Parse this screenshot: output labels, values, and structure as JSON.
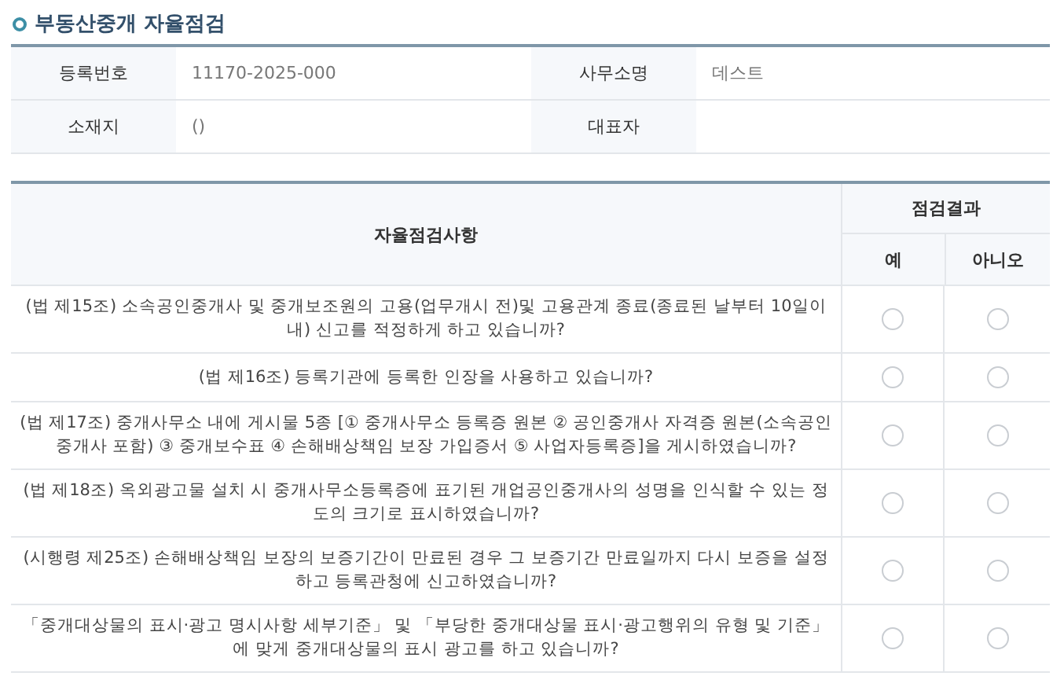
{
  "title": "부동산중개 자율점검",
  "info_rows": [
    [
      {
        "label": "등록번호",
        "value": "11170-2025-000"
      },
      {
        "label": "사무소명",
        "value": "데스트"
      }
    ],
    [
      {
        "label": "소재지",
        "value": "()"
      },
      {
        "label": "대표자"
      }
    ]
  ],
  "checklist": {
    "item_header": "자율점검사항",
    "result_header": "점검결과",
    "options": [
      "예",
      "아니오"
    ],
    "rows": [
      {
        "text": "(법 제15조) 소속공인중개사 및 중개보조원의 고용(업무개시 전)및 고용관계 종료(종료된 날부터 10일이내) 신고를 적정하게 하고 있습니까?",
        "answers": [
          {
            "selected": false
          },
          {
            "selected": false
          }
        ]
      },
      {
        "text": "(법 제16조) 등록기관에 등록한 인장을 사용하고 있습니까?",
        "answers": [
          {
            "selected": false
          },
          {
            "selected": false
          }
        ]
      },
      {
        "text": "(법 제17조) 중개사무소 내에 게시물 5종 [① 중개사무소 등록증 원본 ② 공인중개사 자격증 원본(소속공인중개사 포함) ③ 중개보수표 ④ 손해배상책임 보장 가입증서 ⑤ 사업자등록증]을 게시하였습니까?",
        "answers": [
          {
            "selected": false
          },
          {
            "selected": false
          }
        ]
      },
      {
        "text": "(법 제18조) 옥외광고물 설치 시 중개사무소등록증에 표기된 개업공인중개사의 성명을 인식할 수 있는 정도의 크기로 표시하였습니까?",
        "answers": [
          {
            "selected": false
          },
          {
            "selected": false
          }
        ]
      },
      {
        "text": "(시행령 제25조) 손해배상책임 보장의 보증기간이 만료된 경우 그 보증기간 만료일까지 다시 보증을 설정하고 등록관청에 신고하였습니까?",
        "answers": [
          {
            "selected": false
          },
          {
            "selected": false
          }
        ]
      },
      {
        "text": "「중개대상물의 표시·광고 명시사항 세부기준」 및 「부당한 중개대상물 표시·광고행위의 유형 및 기준」에 맞게 중개대상물의 표시 광고를 하고 있습니까?",
        "answers": [
          {
            "selected": false
          },
          {
            "selected": false
          }
        ]
      }
    ]
  }
}
